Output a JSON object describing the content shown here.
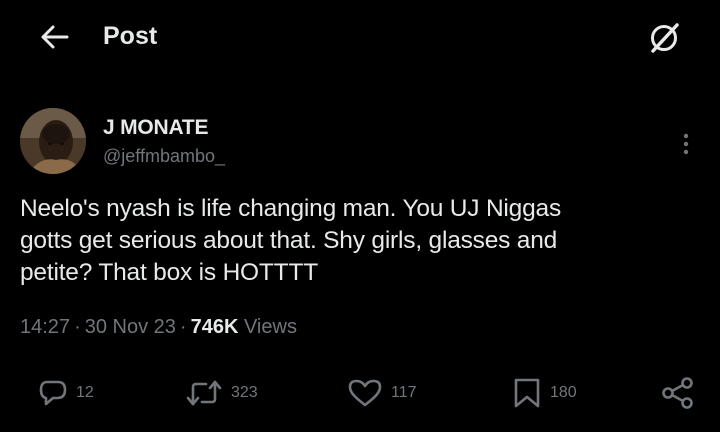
{
  "header": {
    "back_icon": "arrow-left-icon",
    "title": "Post",
    "grok_icon": "grok-icon"
  },
  "author": {
    "name": "J MONATE",
    "handle": "@jeffmbambo_",
    "more_icon": "more-vertical-icon"
  },
  "post": {
    "lines": [
      "Neelo's nyash is life changing man. You UJ Niggas",
      "gotts get serious about that. Shy girls, glasses and",
      "petite? That box is HOTTTT"
    ]
  },
  "meta": {
    "time": "14:27",
    "date": "30 Nov 23",
    "views_count": "746K",
    "views_label": "Views"
  },
  "actions": {
    "reply": {
      "icon": "reply-icon",
      "count": "12"
    },
    "retweet": {
      "icon": "retweet-icon",
      "count": "323"
    },
    "like": {
      "icon": "heart-icon",
      "count": "117"
    },
    "bookmark": {
      "icon": "bookmark-icon",
      "count": "180"
    },
    "share": {
      "icon": "share-icon"
    }
  },
  "colors": {
    "background": "#000000",
    "primary_text": "#e7e9ea",
    "secondary_text": "#71767b"
  }
}
